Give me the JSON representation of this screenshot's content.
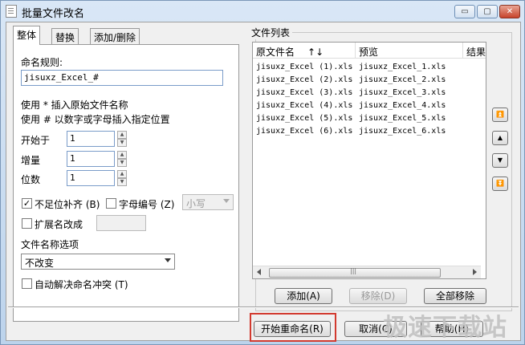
{
  "window": {
    "title": "批量文件改名",
    "controls": {
      "minimize": "▭",
      "maximize": "▢",
      "close": "✕"
    }
  },
  "tabs": [
    "整体",
    "替换",
    "添加/删除"
  ],
  "left": {
    "rule_label": "命名规则:",
    "rule_value": "jisuxz_Excel_#",
    "hint1": "使用 * 插入原始文件名称",
    "hint2": "使用 # 以数字或字母插入指定位置",
    "start_label": "开始于",
    "start_value": "1",
    "step_label": "增量",
    "step_value": "1",
    "digits_label": "位数",
    "digits_value": "1",
    "pad_label": "不足位补齐 (B)",
    "pad_checked": "✓",
    "alpha_label": "字母编号 (Z)",
    "case_value": "小写",
    "ext_label": "扩展名改成",
    "name_option_label": "文件名称选项",
    "name_option_value": "不改变",
    "auto_resolve_label": "自动解决命名冲突 (T)"
  },
  "filelist": {
    "title": "文件列表",
    "headers": {
      "original": "原文件名",
      "sort": "↑↓",
      "preview": "预览",
      "result": "结果"
    },
    "rows": [
      {
        "original": "jisuxz_Excel (1).xls",
        "preview": "jisuxz_Excel_1.xls"
      },
      {
        "original": "jisuxz_Excel (2).xls",
        "preview": "jisuxz_Excel_2.xls"
      },
      {
        "original": "jisuxz_Excel (3).xls",
        "preview": "jisuxz_Excel_3.xls"
      },
      {
        "original": "jisuxz_Excel (4).xls",
        "preview": "jisuxz_Excel_4.xls"
      },
      {
        "original": "jisuxz_Excel (5).xls",
        "preview": "jisuxz_Excel_5.xls"
      },
      {
        "original": "jisuxz_Excel (6).xls",
        "preview": "jisuxz_Excel_6.xls"
      }
    ],
    "scroll_mark": "|||",
    "add_button": "添加(A)",
    "remove_button": "移除(D)",
    "remove_all_button": "全部移除"
  },
  "side_buttons": {
    "top": "⏫",
    "up": "▲",
    "down": "▼",
    "bottom": "⏬"
  },
  "footer": {
    "start_button": "开始重命名(R)",
    "cancel_button": "取消(C)",
    "help_button": "帮助(H)"
  },
  "watermark": "极速下载站"
}
